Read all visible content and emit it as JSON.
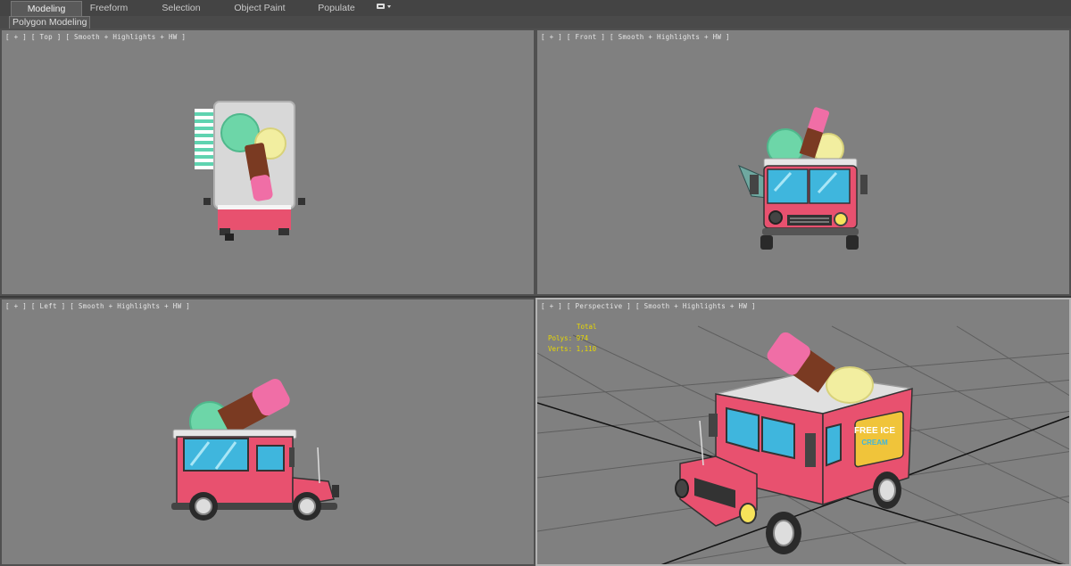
{
  "ribbon": {
    "tabs": [
      {
        "label": "Modeling",
        "active": true
      },
      {
        "label": "Freeform",
        "active": false
      },
      {
        "label": "Selection",
        "active": false
      },
      {
        "label": "Object Paint",
        "active": false
      },
      {
        "label": "Populate",
        "active": false
      }
    ],
    "overflow_icon": "ribbon-options-icon",
    "subtab": "Polygon Modeling"
  },
  "viewports": {
    "top": {
      "label": "[ + ] [ Top ] [ Smooth + Highlights + HW ]"
    },
    "front": {
      "label": "[ + ] [ Front ] [ Smooth + Highlights + HW ]"
    },
    "left": {
      "label": "[ + ] [ Left ] [ Smooth + Highlights + HW ]"
    },
    "perspective": {
      "label": "[ + ] [ Perspective ] [ Smooth + Highlights + HW ]",
      "stats": {
        "header": "Total",
        "polys_label": "Polys:",
        "polys_value": "974",
        "verts_label": "Verts:",
        "verts_value": "1,110"
      },
      "sign_text": [
        "FREE ICE",
        "CREAM"
      ]
    }
  },
  "colors": {
    "viewport_bg": "#808080",
    "truck_pink": "#e8516f",
    "truck_roof": "#dcdcdc",
    "window_blue": "#3fb6dd",
    "mint_scoop": "#6dd6a8",
    "lemon_scoop": "#f2eea0",
    "popsicle_pink": "#f06ea6",
    "popsicle_choc": "#7a3a22",
    "stats_yellow": "#e8d800"
  }
}
